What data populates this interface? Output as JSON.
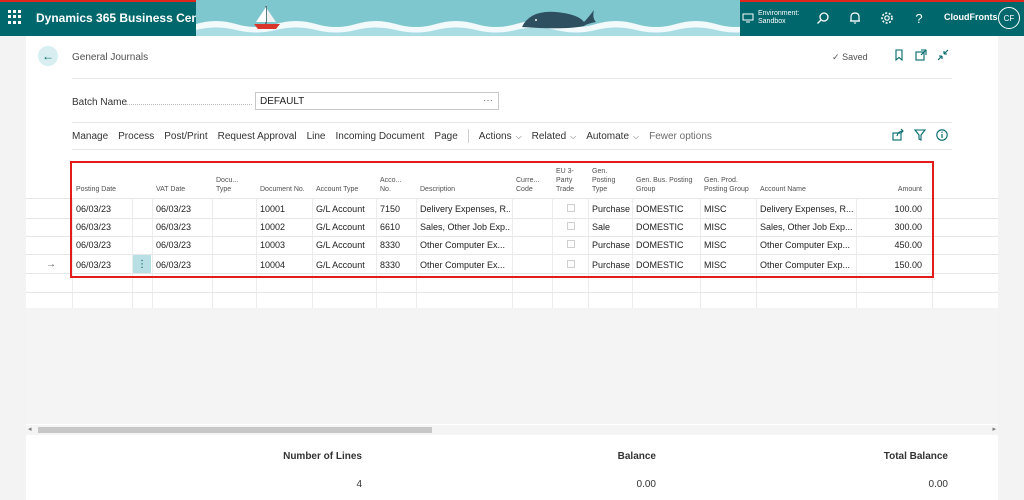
{
  "topbar": {
    "app_title": "Dynamics 365 Business Central",
    "environment_label": "Environment:",
    "environment_value": "Sandbox",
    "user_name": "CloudFronts",
    "user_initials": "CF",
    "brand_color": "#00676c",
    "icons": [
      "waffle-icon",
      "search-icon",
      "bell-icon",
      "gear-icon",
      "help-icon"
    ]
  },
  "header": {
    "title": "General Journals",
    "saved_text": "Saved",
    "icons": [
      "bookmark-icon",
      "open-new-window-icon",
      "collapse-icon"
    ]
  },
  "batch": {
    "label": "Batch Name",
    "value": "DEFAULT",
    "ellipsis": "···"
  },
  "actions": {
    "items": [
      "Manage",
      "Process",
      "Post/Print",
      "Request Approval",
      "Line",
      "Incoming Document",
      "Page"
    ],
    "dropdowns": [
      "Actions",
      "Related",
      "Automate"
    ],
    "fewer_options": "Fewer options",
    "icons": [
      "share-icon",
      "filter-icon",
      "info-icon"
    ]
  },
  "grid": {
    "columns": [
      "Posting Date",
      "VAT Date",
      "Docu... Type",
      "Document No.",
      "Account Type",
      "Acco... No.",
      "Description",
      "Curre... Code",
      "EU 3-Party Trade",
      "Gen. Posting Type",
      "Gen. Bus. Posting Group",
      "Gen. Prod. Posting Group",
      "Account Name",
      "Amount"
    ],
    "rows": [
      {
        "posting_date": "06/03/23",
        "vat_date": "06/03/23",
        "doc_type": "",
        "doc_no": "10001",
        "account_type": "G/L Account",
        "account_no": "7150",
        "description": "Delivery Expenses, R...",
        "currency": "",
        "eu3": false,
        "gen_posting_type": "Purchase",
        "bus_group": "DOMESTIC",
        "prod_group": "MISC",
        "account_name": "Delivery Expenses, R...",
        "amount": "100.00"
      },
      {
        "posting_date": "06/03/23",
        "vat_date": "06/03/23",
        "doc_type": "",
        "doc_no": "10002",
        "account_type": "G/L Account",
        "account_no": "6610",
        "description": "Sales, Other Job Exp...",
        "currency": "",
        "eu3": false,
        "gen_posting_type": "Sale",
        "bus_group": "DOMESTIC",
        "prod_group": "MISC",
        "account_name": "Sales, Other Job Exp...",
        "amount": "300.00"
      },
      {
        "posting_date": "06/03/23",
        "vat_date": "06/03/23",
        "doc_type": "",
        "doc_no": "10003",
        "account_type": "G/L Account",
        "account_no": "8330",
        "description": "Other Computer Ex...",
        "currency": "",
        "eu3": false,
        "gen_posting_type": "Purchase",
        "bus_group": "DOMESTIC",
        "prod_group": "MISC",
        "account_name": "Other Computer Exp...",
        "amount": "450.00"
      },
      {
        "posting_date": "06/03/23",
        "vat_date": "06/03/23",
        "doc_type": "",
        "doc_no": "10004",
        "account_type": "G/L Account",
        "account_no": "8330",
        "description": "Other Computer Ex...",
        "currency": "",
        "eu3": false,
        "gen_posting_type": "Purchase",
        "bus_group": "DOMESTIC",
        "prod_group": "MISC",
        "account_name": "Other Computer Exp...",
        "amount": "150.00"
      }
    ],
    "highlight_color": "#e21b1b"
  },
  "footer": {
    "number_of_lines_label": "Number of Lines",
    "number_of_lines_value": "4",
    "balance_label": "Balance",
    "balance_value": "0.00",
    "total_balance_label": "Total Balance",
    "total_balance_value": "0.00"
  }
}
